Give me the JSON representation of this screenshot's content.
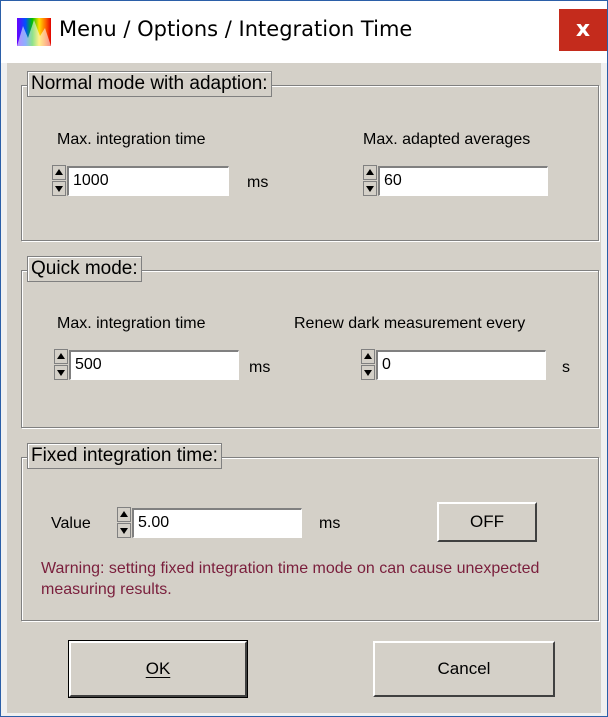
{
  "window": {
    "title": "Menu / Options / Integration Time",
    "close_label": "x",
    "icon": "spectrum-app-icon"
  },
  "normal_mode": {
    "legend": "Normal mode with adaption:",
    "max_time_label": "Max. integration time",
    "max_time_value": "1000",
    "max_time_unit": "ms",
    "max_avg_label": "Max. adapted averages",
    "max_avg_value": "60"
  },
  "quick_mode": {
    "legend": "Quick mode:",
    "max_time_label": "Max. integration time",
    "max_time_value": "500",
    "max_time_unit": "ms",
    "renew_label": "Renew dark measurement every",
    "renew_value": "0",
    "renew_unit": "s"
  },
  "fixed_mode": {
    "legend": "Fixed integration time:",
    "value_label": "Value",
    "value": "5.00",
    "unit": "ms",
    "toggle_label": "OFF",
    "warning": "Warning: setting fixed integration time mode on can cause unexpected measuring results."
  },
  "buttons": {
    "ok_label": "OK",
    "cancel_label": "Cancel"
  },
  "colors": {
    "close": "#c42b1c",
    "warning_text": "#7a1e3c",
    "dialog_face": "#d4d0c8"
  }
}
